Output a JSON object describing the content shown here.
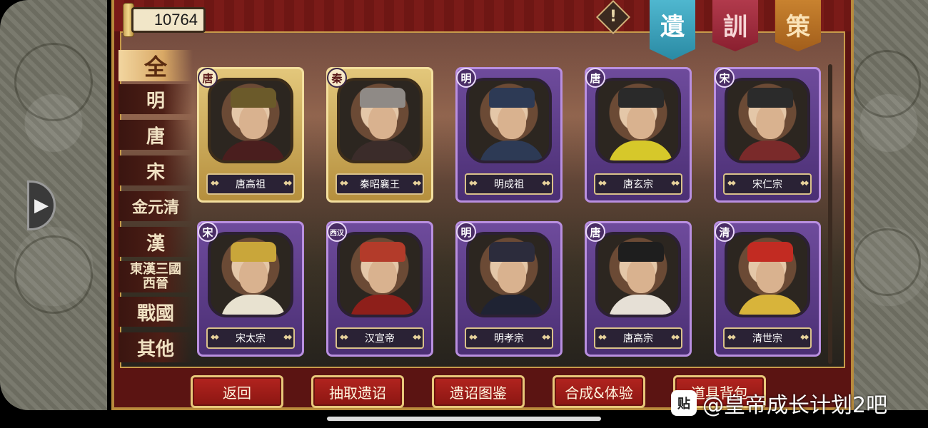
{
  "currency": {
    "amount": "10764"
  },
  "warning_icon_label": "!",
  "flags": [
    {
      "label": "遺",
      "color": "#3aa0bb"
    },
    {
      "label": "訓",
      "color": "#a12a3c"
    },
    {
      "label": "策",
      "color": "#b8722a"
    }
  ],
  "categories": [
    {
      "label": "全",
      "active": true
    },
    {
      "label": "明"
    },
    {
      "label": "唐"
    },
    {
      "label": "宋"
    },
    {
      "label": "金元清"
    },
    {
      "label": "漢"
    },
    {
      "label": "東漢三國西晉"
    },
    {
      "label": "戰國"
    },
    {
      "label": "其他"
    }
  ],
  "cards": [
    {
      "badge": "唐",
      "name": "唐高祖",
      "style": "gold",
      "hat": "#6b5a2a",
      "body": "#4a1e1e"
    },
    {
      "badge": "秦",
      "name": "秦昭襄王",
      "style": "gold",
      "hat": "#8f8a86",
      "body": "#3b2c2a"
    },
    {
      "badge": "明",
      "name": "明成祖",
      "style": "purple",
      "hat": "#2d3a55",
      "body": "#2d3a55"
    },
    {
      "badge": "唐",
      "name": "唐玄宗",
      "style": "purple",
      "hat": "#2a2a2a",
      "body": "#d6c82a"
    },
    {
      "badge": "宋",
      "name": "宋仁宗",
      "style": "purple",
      "hat": "#2b2b2b",
      "body": "#7a2a2a"
    },
    {
      "badge": "宋",
      "name": "宋太宗",
      "style": "purple",
      "hat": "#c9a63a",
      "body": "#e8e2d0"
    },
    {
      "badge": "西汉",
      "name": "汉宣帝",
      "style": "purple",
      "hat": "#b33b2a",
      "body": "#8e1f1a"
    },
    {
      "badge": "明",
      "name": "明孝宗",
      "style": "purple",
      "hat": "#2c2c3c",
      "body": "#1f2333"
    },
    {
      "badge": "唐",
      "name": "唐高宗",
      "style": "purple",
      "hat": "#1e1e1e",
      "body": "#e6e0d6"
    },
    {
      "badge": "清",
      "name": "清世宗",
      "style": "purple",
      "hat": "#c22b22",
      "body": "#d8b43a"
    }
  ],
  "buttons": [
    {
      "label": "返回"
    },
    {
      "label": "抽取遗诏"
    },
    {
      "label": "遗诏图鉴"
    },
    {
      "label": "合成&体验"
    },
    {
      "label": "道具背包"
    }
  ],
  "watermark": {
    "logo": "贴",
    "text": "@皇帝成长计划2吧"
  }
}
